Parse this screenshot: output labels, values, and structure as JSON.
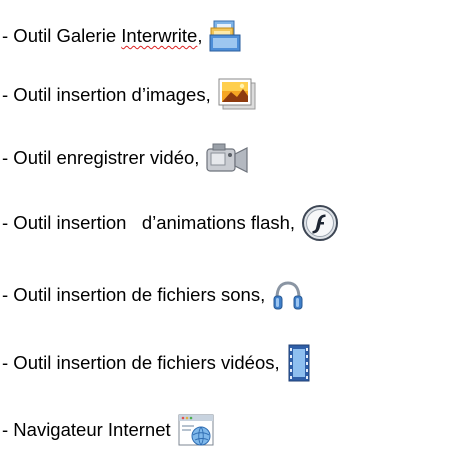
{
  "items": [
    {
      "prefix": "- Outil Galerie ",
      "emphasis": "Interwrite",
      "suffix": ",",
      "icon": "gallery-icon"
    },
    {
      "text": "- Outil insertion d’images,",
      "icon": "image-icon"
    },
    {
      "text": "- Outil enregistrer vidéo,",
      "icon": "video-camera-icon"
    },
    {
      "text": "- Outil insertion   d’animations flash,",
      "icon": "flash-icon"
    },
    {
      "text": "- Outil insertion de fichiers sons,",
      "icon": "headphones-icon"
    },
    {
      "text": "- Outil insertion de fichiers vidéos,",
      "icon": "film-strip-icon"
    },
    {
      "text": "- Navigateur Internet",
      "icon": "web-browser-icon"
    }
  ]
}
